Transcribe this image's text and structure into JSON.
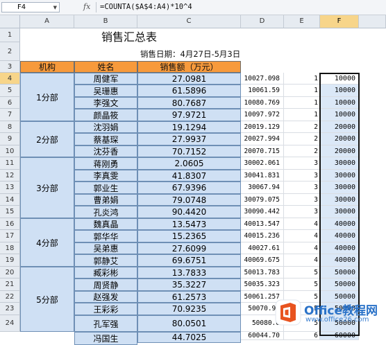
{
  "formula_bar": {
    "name_box": "F4",
    "fx_symbol": "fx",
    "formula": "=COUNTA($A$4:A4)*10^4"
  },
  "columns": [
    "A",
    "B",
    "C",
    "D",
    "E",
    "F"
  ],
  "rows": [
    "1",
    "2",
    "3",
    "4",
    "5",
    "6",
    "7",
    "8",
    "9",
    "10",
    "11",
    "12",
    "13",
    "14",
    "15",
    "16",
    "17",
    "18",
    "19",
    "20",
    "21",
    "22",
    "23",
    "24"
  ],
  "sheet": {
    "title": "销售汇总表",
    "subtitle": "销售日期：4月27日-5月3日",
    "headers": {
      "dept": "机构",
      "name": "姓名",
      "amount": "销售额（万元）"
    },
    "departments": [
      {
        "label": "1分部"
      },
      {
        "label": "2分部"
      },
      {
        "label": "3分部"
      },
      {
        "label": "4分部"
      },
      {
        "label": "5分部"
      }
    ],
    "records": [
      {
        "name": "周健军",
        "amount": "27.0981",
        "d": "10027.098",
        "e": "1",
        "f": "10000"
      },
      {
        "name": "吴珊惠",
        "amount": "61.5896",
        "d": "10061.59",
        "e": "1",
        "f": "10000"
      },
      {
        "name": "李强文",
        "amount": "80.7687",
        "d": "10080.769",
        "e": "1",
        "f": "10000"
      },
      {
        "name": "颜晶筱",
        "amount": "97.9721",
        "d": "10097.972",
        "e": "1",
        "f": "10000"
      },
      {
        "name": "沈羽娟",
        "amount": "19.1294",
        "d": "20019.129",
        "e": "2",
        "f": "20000"
      },
      {
        "name": "蔡基琛",
        "amount": "27.9937",
        "d": "20027.994",
        "e": "2",
        "f": "20000"
      },
      {
        "name": "沈芬香",
        "amount": "70.7152",
        "d": "20070.715",
        "e": "2",
        "f": "20000"
      },
      {
        "name": "蒋刚勇",
        "amount": "2.0605",
        "d": "30002.061",
        "e": "3",
        "f": "30000"
      },
      {
        "name": "李真雯",
        "amount": "41.8307",
        "d": "30041.831",
        "e": "3",
        "f": "30000"
      },
      {
        "name": "郭业生",
        "amount": "67.9396",
        "d": "30067.94",
        "e": "3",
        "f": "30000"
      },
      {
        "name": "曹弟娟",
        "amount": "79.0748",
        "d": "30079.075",
        "e": "3",
        "f": "30000"
      },
      {
        "name": "孔炎鸿",
        "amount": "90.4420",
        "d": "30090.442",
        "e": "3",
        "f": "30000"
      },
      {
        "name": "魏真晶",
        "amount": "13.5473",
        "d": "40013.547",
        "e": "4",
        "f": "40000"
      },
      {
        "name": "郭华华",
        "amount": "15.2365",
        "d": "40015.236",
        "e": "4",
        "f": "40000"
      },
      {
        "name": "吴弟惠",
        "amount": "27.6099",
        "d": "40027.61",
        "e": "4",
        "f": "40000"
      },
      {
        "name": "郭静艾",
        "amount": "69.6751",
        "d": "40069.675",
        "e": "4",
        "f": "40000"
      },
      {
        "name": "臧彩彬",
        "amount": "13.7833",
        "d": "50013.783",
        "e": "5",
        "f": "50000"
      },
      {
        "name": "周贤静",
        "amount": "35.3227",
        "d": "50035.323",
        "e": "5",
        "f": "50000"
      },
      {
        "name": "赵强发",
        "amount": "61.2573",
        "d": "50061.257",
        "e": "5",
        "f": "50000"
      },
      {
        "name": "王彩彩",
        "amount": "70.9235",
        "d": "50070.92",
        "e": "5",
        "f": "50000"
      },
      {
        "name": "孔军强",
        "amount": "80.0501",
        "d": "50080.0",
        "e": "5",
        "f": "50000"
      },
      {
        "name": "冯国生",
        "amount": "44.7025",
        "d": "60044.70",
        "e": "6",
        "f": "60000"
      }
    ]
  },
  "watermark": {
    "brand": "Office教程网",
    "url": "www.office26.com"
  }
}
